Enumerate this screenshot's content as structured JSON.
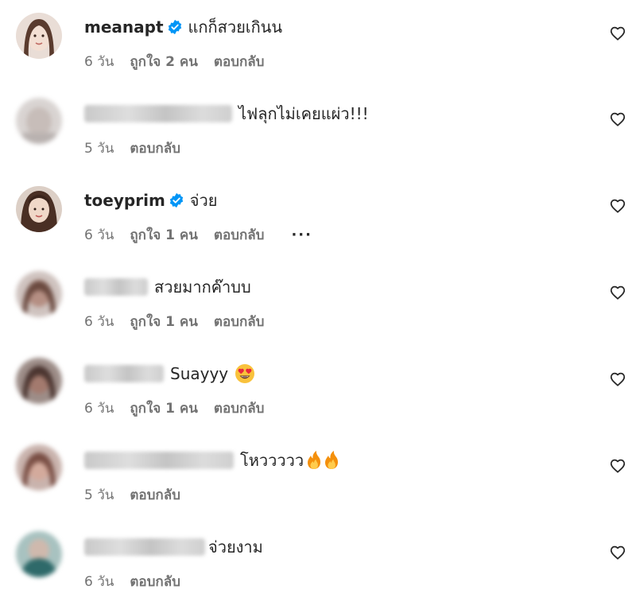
{
  "comments": [
    {
      "username": "meanapt",
      "verified": true,
      "text": "แกก็สวยเกินน",
      "time": "6 วัน",
      "likes": "ถูกใจ 2 คน",
      "reply": "ตอบกลับ"
    },
    {
      "username": "",
      "verified": false,
      "text": "ไฟลุกไม่เคยแผ่ว!!!",
      "time": "5 วัน",
      "likes": "",
      "reply": "ตอบกลับ"
    },
    {
      "username": "toeyprim",
      "verified": true,
      "text": "จ่วย",
      "time": "6 วัน",
      "likes": "ถูกใจ 1 คน",
      "reply": "ตอบกลับ",
      "more": "···"
    },
    {
      "username": "",
      "verified": false,
      "text": "สวยมากค๊าบบ",
      "time": "6 วัน",
      "likes": "ถูกใจ 1 คน",
      "reply": "ตอบกลับ"
    },
    {
      "username": "",
      "verified": false,
      "text": "Suayyy",
      "emoji": "heart-eyes-emoji",
      "time": "6 วัน",
      "likes": "ถูกใจ 1 คน",
      "reply": "ตอบกลับ"
    },
    {
      "username": "",
      "verified": false,
      "text": "โหววววว",
      "emoji": "fire-emoji",
      "time": "5 วัน",
      "likes": "",
      "reply": "ตอบกลับ"
    },
    {
      "username": "",
      "verified": false,
      "text": "จ่วยงาม",
      "time": "6 วัน",
      "likes": "",
      "reply": "ตอบกลับ"
    }
  ],
  "colors": {
    "text": "#262626",
    "meta": "#737373",
    "verified": "#0095f6"
  },
  "icons": {
    "verified": "verified-badge-icon",
    "like": "heart-outline-icon"
  }
}
